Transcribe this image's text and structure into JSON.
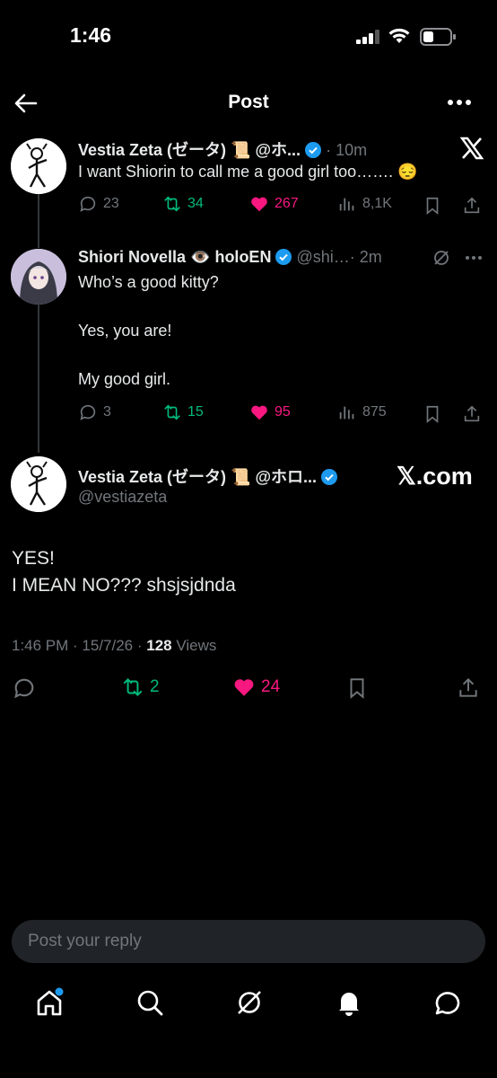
{
  "status_bar": {
    "time": "1:46"
  },
  "header": {
    "title": "Post"
  },
  "tweet1": {
    "name": "Vestia Zeta (ゼータ) 📜",
    "handle": "@ホ...",
    "time": "· 10m",
    "text": "I want Shiorin to call me a good girl too……. 😔",
    "replies": "23",
    "retweets": "34",
    "likes": "267",
    "views": "8,1K"
  },
  "tweet2": {
    "name": "Shiori Novella 👁️ holoEN",
    "handle": "@shi…",
    "time": "· 2m",
    "text": "Who’s a good kitty?\n\nYes, you are!\n\nMy good girl.",
    "replies": "3",
    "retweets": "15",
    "likes": "95",
    "views": "875"
  },
  "main_tweet": {
    "name": "Vestia Zeta (ゼータ) 📜 @ホロ...",
    "username": "@vestiazeta",
    "watermark": "𝕏.com",
    "text": "YES!\nI MEAN NO??? shsjsjdnda",
    "timestamp": "1:46 PM · 15/7/26 · ",
    "views_count": "128",
    "views_label": " Views",
    "retweets": "2",
    "likes": "24"
  },
  "reply": {
    "placeholder": "Post your reply"
  },
  "colors": {
    "like": "#f91880",
    "retweet": "#00ba7c",
    "verified": "#1d9bf0",
    "muted": "#71767b"
  }
}
